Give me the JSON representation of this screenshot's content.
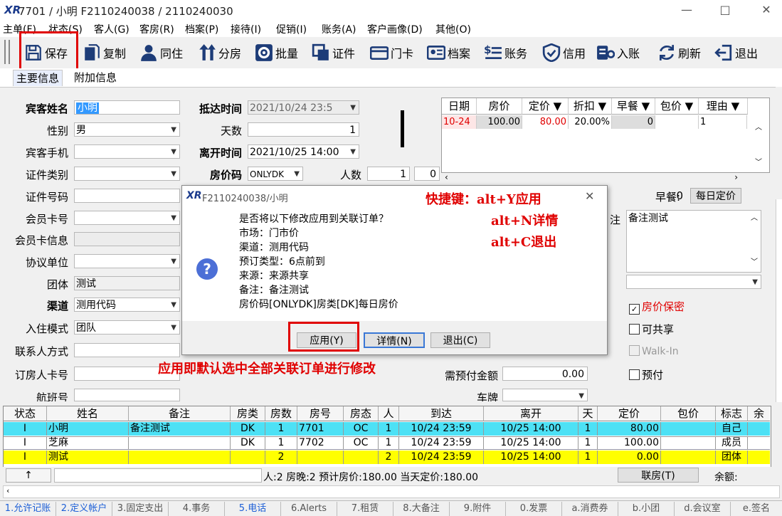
{
  "window": {
    "title": "7701 / 小明 F2110240038 / 2110240030",
    "logo": "XR",
    "min": "—",
    "max": "□",
    "close": "✕"
  },
  "menu": [
    "主单(F)",
    "状态(S)",
    "客人(G)",
    "客房(R)",
    "档案(P)",
    "接待(I)",
    "促销(I)",
    "账务(A)",
    "客户画像(D)",
    "其他(O)"
  ],
  "toolbar": {
    "save": "保存",
    "copy": "复制",
    "share": "同住",
    "split": "分房",
    "batch": "批量",
    "cert": "证件",
    "card": "门卡",
    "profile": "档案",
    "account": "账务",
    "credit": "信用",
    "posting": "入账",
    "refresh": "刷新",
    "exit": "退出"
  },
  "tabs": {
    "main": "主要信息",
    "extra": "附加信息"
  },
  "form": {
    "guest_name_label": "宾客姓名",
    "guest_name": "小明",
    "gender_label": "性别",
    "gender": "男",
    "phone_label": "宾客手机",
    "phone": "",
    "id_type_label": "证件类别",
    "id_type": "",
    "id_no_label": "证件号码",
    "id_no": "",
    "member_no_label": "会员卡号",
    "member_no": "",
    "member_info_label": "会员卡信息",
    "member_info": "",
    "agreement_label": "协议单位",
    "agreement": "",
    "group_label": "团体",
    "group": "测试",
    "channel_label": "渠道",
    "channel": "测用代码",
    "checkin_mode_label": "入住模式",
    "checkin_mode": "团队",
    "contact_label": "联系人方式",
    "contact": "",
    "booker_label": "订房人卡号",
    "booker": "",
    "flight_label": "航班号",
    "flight": "",
    "arrive_label": "抵达时间",
    "arrive": "2021/10/24 23:5",
    "days_label": "天数",
    "days": "1",
    "depart_label": "离开时间",
    "depart": "2021/10/25 14:00",
    "rate_code_label": "房价码",
    "rate_code": "ONLYDK",
    "persons_label": "人数",
    "persons": "1",
    "persons2": "0",
    "breakfast_label": "早餐:",
    "breakfast": "0",
    "daily_rate_btn": "每日定价",
    "remark_label": "注",
    "remark": "备注测试",
    "rate_secret": "房价保密",
    "shareable": "可共享",
    "walkin": "Walk-In",
    "prepaid": "预付",
    "prepay_label": "需预付金额",
    "prepay": "0.00",
    "plate_label": "车牌"
  },
  "rate_grid": {
    "headers": [
      "日期",
      "房价",
      "定价 ▼",
      "折扣 ▼",
      "早餐 ▼",
      "包价 ▼",
      "理由 ▼"
    ],
    "row": [
      "10-24",
      "100.00",
      "80.00",
      "20.00%",
      "0",
      "",
      "1"
    ]
  },
  "dialog": {
    "title": "F2110240038/小明",
    "close": "✕",
    "lines": [
      "是否将以下修改应用到关联订单？",
      "市场：门市价",
      "渠道：测用代码",
      "预订类型：6点前到",
      "来源：来源共享",
      "备注：备注测试",
      "房价码[ONLYDK]房类[DK]每日房价"
    ],
    "apply": "应用(Y)",
    "detail": "详情(N)",
    "exit": "退出(C)"
  },
  "annotations": {
    "shortcut1": "快捷键：alt+Y应用",
    "shortcut2": "alt+N详情",
    "shortcut3": "alt+C退出",
    "note": "应用即默认选中全部关联订单进行修改"
  },
  "grid": {
    "headers": [
      "状态",
      "姓名",
      "备注",
      "房类",
      "房数",
      "房号",
      "房态",
      "人",
      "到达",
      "离开",
      "天",
      "定价",
      "包价",
      "标志",
      "余"
    ],
    "rows": [
      [
        "I",
        "小明",
        "备注测试",
        "DK",
        "1",
        "7701",
        "OC",
        "1",
        "10/24 23:59",
        "10/25 14:00",
        "1",
        "80.00",
        "",
        "自己"
      ],
      [
        "I",
        "芝麻",
        "",
        "DK",
        "1",
        "7702",
        "OC",
        "1",
        "10/24 23:59",
        "10/25 14:00",
        "1",
        "100.00",
        "",
        "成员"
      ],
      [
        "I",
        "测试",
        "",
        "",
        "2",
        "",
        "",
        "2",
        "10/24 23:59",
        "10/25 14:00",
        "1",
        "0.00",
        "",
        "团体"
      ]
    ]
  },
  "summary": {
    "arrow": "↑",
    "text": "人:2  房晚:2  预计房价:180.00  当天定价:180.00",
    "link_btn": "联房(T)",
    "balance": "余额:"
  },
  "bottom_tabs": [
    "1.允许记账",
    "2.定义帐户",
    "3.固定支出",
    "4.事务",
    "5.电话",
    "6.Alerts",
    "7.租赁",
    "8.大备注",
    "9.附件",
    "0.发票",
    "a.消费券",
    "b.小团",
    "d.会议室",
    "e.签名"
  ],
  "colors": {
    "accent": "#3399ff",
    "red": "#e00000",
    "cyan_row": "#4de1f5",
    "yellow_row": "#ffff00"
  }
}
